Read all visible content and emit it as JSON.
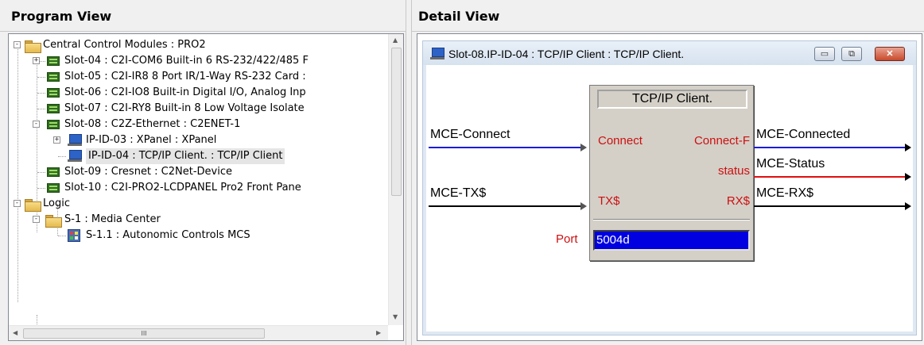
{
  "program_view": {
    "title": "Program View",
    "tree": [
      {
        "label": "Central Control Modules : PRO2",
        "icon": "folder-open-icon",
        "expander": "-",
        "depth": 0
      },
      {
        "label": "Slot-04 : C2I-COM6 Built-in 6 RS-232/422/485 F",
        "icon": "card-icon",
        "expander": "+",
        "depth": 1
      },
      {
        "label": "Slot-05 : C2I-IR8 8 Port IR/1-Way RS-232 Card :",
        "icon": "card-icon",
        "expander": "",
        "depth": 1
      },
      {
        "label": "Slot-06 : C2I-IO8 Built-in Digital I/O, Analog Inp",
        "icon": "card-icon",
        "expander": "",
        "depth": 1
      },
      {
        "label": "Slot-07 : C2I-RY8 Built-in 8 Low Voltage Isolate",
        "icon": "card-icon",
        "expander": "",
        "depth": 1
      },
      {
        "label": "Slot-08 : C2Z-Ethernet : C2ENET-1",
        "icon": "card-icon",
        "expander": "-",
        "depth": 1
      },
      {
        "label": "IP-ID-03 : XPanel : XPanel",
        "icon": "computer-icon",
        "expander": "+",
        "depth": 2
      },
      {
        "label": "IP-ID-04 : TCP/IP Client. : TCP/IP Client",
        "icon": "computer-icon",
        "expander": "",
        "depth": 2,
        "selected": true
      },
      {
        "label": "Slot-09 : Cresnet : C2Net-Device",
        "icon": "card-icon",
        "expander": "",
        "depth": 1
      },
      {
        "label": "Slot-10 : C2I-PRO2-LCDPANEL Pro2 Front Pane",
        "icon": "card-icon",
        "expander": "",
        "depth": 1
      },
      {
        "label": "Logic",
        "icon": "folder-open-icon",
        "expander": "-",
        "depth": 0
      },
      {
        "label": "S-1 : Media Center",
        "icon": "folder-open-icon",
        "expander": "-",
        "depth": 1
      },
      {
        "label": "S-1.1 : Autonomic Controls MCS",
        "icon": "logic-module-icon",
        "expander": "",
        "depth": 2
      }
    ],
    "hscroll_thumb_glyph": "III"
  },
  "detail_view": {
    "title": "Detail View",
    "window_title": "Slot-08.IP-ID-04 : TCP/IP Client : TCP/IP Client.",
    "window_buttons": {
      "minimize": "▭",
      "restore": "⧉",
      "close": "✕"
    },
    "symbol": {
      "name": "TCP/IP Client.",
      "inputs": [
        {
          "port": "Connect",
          "signal": "MCE-Connect",
          "wire_color": "#1a1ae0"
        },
        {
          "port": "TX$",
          "signal": "MCE-TX$",
          "wire_color": "#000000"
        }
      ],
      "outputs": [
        {
          "port": "Connect-F",
          "signal": "MCE-Connected",
          "wire_color": "#1a1ae0"
        },
        {
          "port": "status",
          "signal": "MCE-Status",
          "wire_color": "#e01010"
        },
        {
          "port": "RX$",
          "signal": "MCE-RX$",
          "wire_color": "#000000"
        }
      ],
      "parameter": {
        "label": "Port",
        "value": "5004d"
      }
    }
  }
}
